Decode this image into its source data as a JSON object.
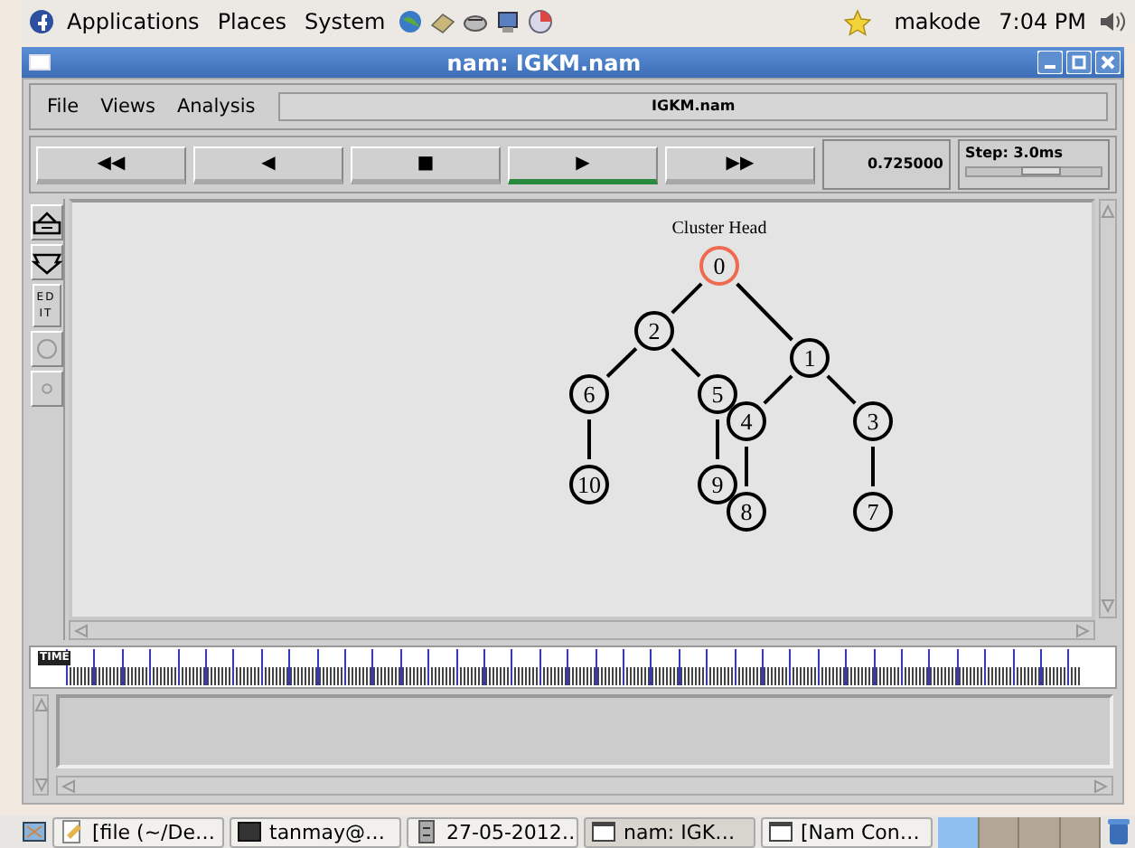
{
  "top_panel": {
    "menus": [
      "Applications",
      "Places",
      "System"
    ],
    "user": "makode",
    "clock": "7:04 PM"
  },
  "window": {
    "title": "nam: IGKM.nam"
  },
  "menu_bar": {
    "items": [
      "File",
      "Views",
      "Analysis"
    ],
    "file_name": "IGKM.nam"
  },
  "playback": {
    "buttons": [
      {
        "label": "◀◀",
        "selected": false
      },
      {
        "label": "◀",
        "selected": false
      },
      {
        "label": "■",
        "selected": false
      },
      {
        "label": "▶",
        "selected": true
      },
      {
        "label": "▶▶",
        "selected": false
      }
    ],
    "time": "0.725000",
    "step": {
      "label": "Step: 3.0ms",
      "level": 0.55
    }
  },
  "tools": [
    {
      "kind": "zoom-in"
    },
    {
      "kind": "zoom-out"
    },
    {
      "kind": "text",
      "label": "EDIT"
    },
    {
      "kind": "circle"
    },
    {
      "kind": "dot"
    }
  ],
  "network": {
    "caption": "Cluster Head",
    "root": {
      "label": "0",
      "color": "#f06a50",
      "children": [
        {
          "label": "2",
          "color": "#000000",
          "children": [
            {
              "label": "6",
              "color": "#000000",
              "children": [
                {
                  "label": "10",
                  "color": "#000000"
                }
              ]
            },
            {
              "label": "5",
              "color": "#000000",
              "children": [
                {
                  "label": "9",
                  "color": "#000000"
                }
              ]
            }
          ]
        },
        {
          "label": "1",
          "color": "#000000",
          "children": [
            {
              "label": "4",
              "color": "#000000",
              "children": [
                {
                  "label": "8",
                  "color": "#000000"
                }
              ]
            },
            {
              "label": "3",
              "color": "#000000",
              "children": [
                {
                  "label": "7",
                  "color": "#000000"
                }
              ]
            }
          ]
        }
      ]
    }
  },
  "timeline": {
    "thumb": "TIME",
    "level": 0
  },
  "taskbar": {
    "items": [
      {
        "label": "[file (~/De…",
        "kind": "editor",
        "selected": false
      },
      {
        "label": "tanmay@…",
        "kind": "terminal",
        "selected": false
      },
      {
        "label": "27-05-2012…",
        "kind": "file",
        "selected": false
      },
      {
        "label": "nam: IGK…",
        "kind": "window",
        "selected": true
      },
      {
        "label": "[Nam Con…",
        "kind": "window",
        "selected": false
      }
    ],
    "workspaces": [
      {
        "selected": true
      },
      {
        "selected": false
      },
      {
        "selected": false
      },
      {
        "selected": false
      }
    ]
  }
}
